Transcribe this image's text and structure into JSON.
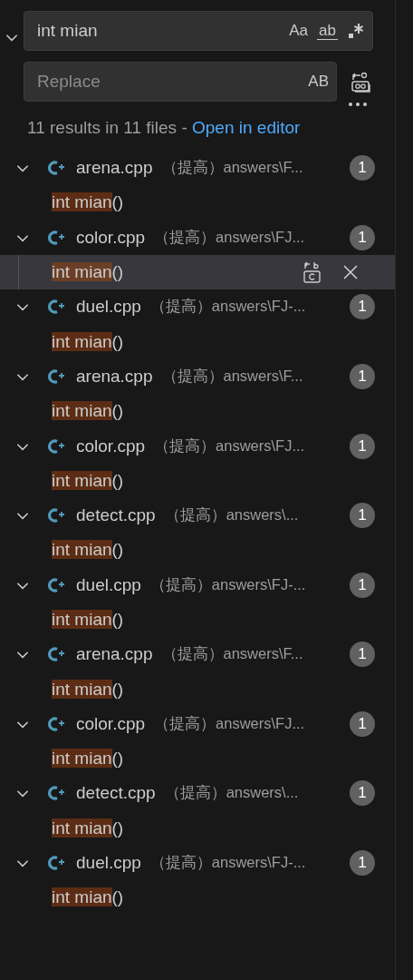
{
  "search": {
    "value": "int mian",
    "toggles": [
      "Aa",
      "ab"
    ]
  },
  "replace": {
    "placeholder": "Replace",
    "toggle": "AB",
    "expanded": true
  },
  "summary": {
    "text": "11 results in 11 files - ",
    "link": "Open in editor"
  },
  "files": [
    {
      "name": "arena.cpp",
      "folder": "（提高）",
      "path": "answers\\F...",
      "count": "1",
      "expanded": true,
      "matches": [
        {
          "match": "int mian",
          "after": "()",
          "selected": false
        }
      ]
    },
    {
      "name": "color.cpp",
      "folder": "（提高）",
      "path": "answers\\FJ...",
      "count": "1",
      "expanded": true,
      "matches": [
        {
          "match": "int mian",
          "after": "()",
          "selected": true
        }
      ]
    },
    {
      "name": "duel.cpp",
      "folder": "（提高）",
      "path": "answers\\FJ-...",
      "count": "1",
      "expanded": true,
      "matches": [
        {
          "match": "int mian",
          "after": "()",
          "selected": false
        }
      ]
    },
    {
      "name": "arena.cpp",
      "folder": "（提高）",
      "path": "answers\\F...",
      "count": "1",
      "expanded": true,
      "matches": [
        {
          "match": "int mian",
          "after": "()",
          "selected": false
        }
      ]
    },
    {
      "name": "color.cpp",
      "folder": "（提高）",
      "path": "answers\\FJ...",
      "count": "1",
      "expanded": true,
      "matches": [
        {
          "match": "int mian",
          "after": "()",
          "selected": false
        }
      ]
    },
    {
      "name": "detect.cpp",
      "folder": "（提高）",
      "path": "answers\\...",
      "count": "1",
      "expanded": true,
      "matches": [
        {
          "match": "int mian",
          "after": "()",
          "selected": false
        }
      ]
    },
    {
      "name": "duel.cpp",
      "folder": "（提高）",
      "path": "answers\\FJ-...",
      "count": "1",
      "expanded": true,
      "matches": [
        {
          "match": "int mian",
          "after": "()",
          "selected": false
        }
      ]
    },
    {
      "name": "arena.cpp",
      "folder": "（提高）",
      "path": "answers\\F...",
      "count": "1",
      "expanded": true,
      "matches": [
        {
          "match": "int mian",
          "after": "()",
          "selected": false
        }
      ]
    },
    {
      "name": "color.cpp",
      "folder": "（提高）",
      "path": "answers\\FJ...",
      "count": "1",
      "expanded": true,
      "matches": [
        {
          "match": "int mian",
          "after": "()",
          "selected": false
        }
      ]
    },
    {
      "name": "detect.cpp",
      "folder": "（提高）",
      "path": "answers\\...",
      "count": "1",
      "expanded": true,
      "matches": [
        {
          "match": "int mian",
          "after": "()",
          "selected": false
        }
      ]
    },
    {
      "name": "duel.cpp",
      "folder": "（提高）",
      "path": "answers\\FJ-...",
      "count": "1",
      "expanded": true,
      "matches": [
        {
          "match": "int mian",
          "after": "()",
          "selected": false
        }
      ]
    }
  ]
}
